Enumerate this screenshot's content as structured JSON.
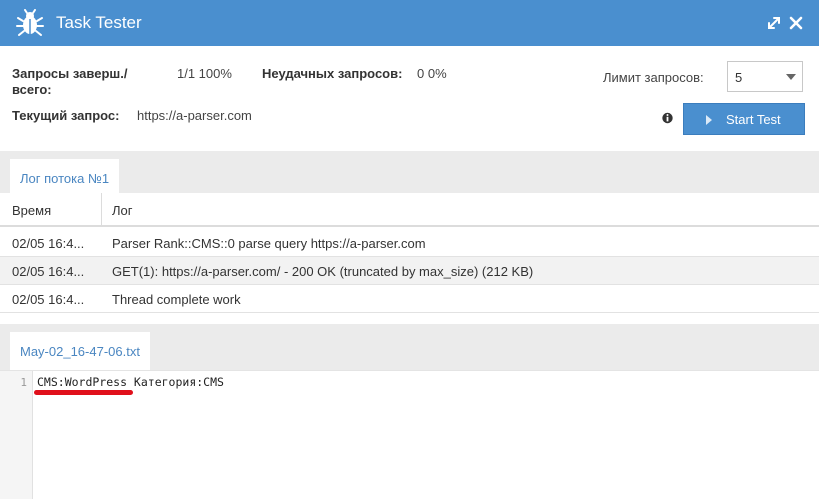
{
  "window": {
    "title": "Task Tester",
    "accent": "#4a8fcf",
    "icons": {
      "app": "bug-icon",
      "expand": "expand-icon",
      "close": "close-icon"
    }
  },
  "stats": {
    "completed_label": "Запросы заверш./",
    "completed_label_2": "всего:",
    "completed_value": "1/1 100%",
    "failed_label": "Неудачных запросов:",
    "failed_value": "0 0%",
    "current_label": "Текущий запрос:",
    "current_value": "https://a-parser.com"
  },
  "controls": {
    "limit_label": "Лимит запросов:",
    "limit_value": "5",
    "start_label": "Start Test"
  },
  "log": {
    "tab_label": "Лог потока №1",
    "columns": {
      "time": "Время",
      "log": "Лог"
    },
    "rows": [
      {
        "time": "02/05 16:4...",
        "msg": "Parser Rank::CMS::0 parse query https://a-parser.com"
      },
      {
        "time": "02/05 16:4...",
        "msg": "GET(1): https://a-parser.com/ - 200 OK (truncated by max_size) (212 KB)"
      },
      {
        "time": "02/05 16:4...",
        "msg": "Thread complete work"
      }
    ]
  },
  "result": {
    "tab_label": "May-02_16-47-06.txt",
    "line_number": "1",
    "line_text": "CMS:WordPress Категория:CMS",
    "highlight_color": "#e0101b"
  }
}
